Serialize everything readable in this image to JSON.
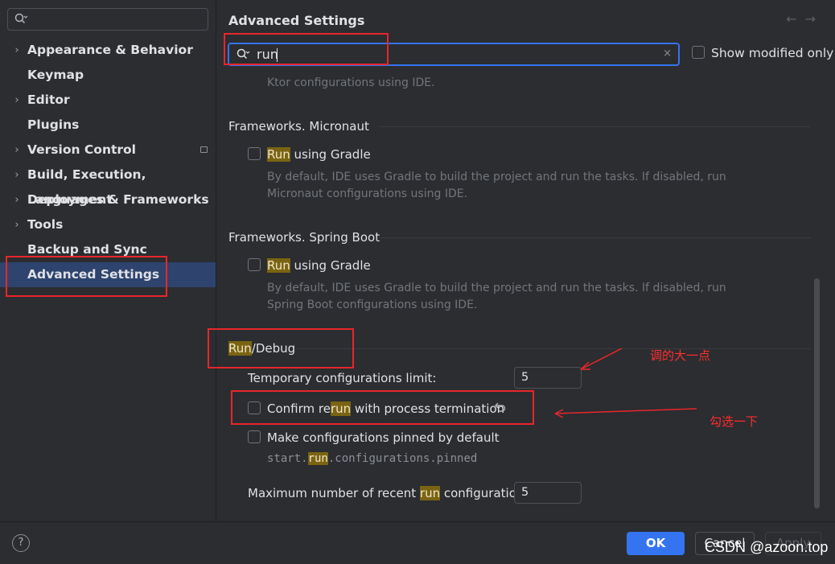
{
  "sidebar": {
    "search": {
      "value": ""
    },
    "items": [
      {
        "label": "Appearance & Behavior",
        "expandable": true
      },
      {
        "label": "Keymap",
        "expandable": false
      },
      {
        "label": "Editor",
        "expandable": true
      },
      {
        "label": "Plugins",
        "expandable": false
      },
      {
        "label": "Version Control",
        "expandable": true
      },
      {
        "label": "Build, Execution, Deployment",
        "expandable": true
      },
      {
        "label": "Languages & Frameworks",
        "expandable": true
      },
      {
        "label": "Tools",
        "expandable": true
      },
      {
        "label": "Backup and Sync",
        "expandable": false
      },
      {
        "label": "Advanced Settings",
        "expandable": false,
        "selected": true
      }
    ]
  },
  "header": {
    "title": "Advanced Settings",
    "back_arrow": "←",
    "forward_arrow": "→"
  },
  "search": {
    "value": "run",
    "clear_glyph": "×",
    "show_modified_label": "Show modified only"
  },
  "sections": {
    "ktor_tail": "Ktor configurations using IDE.",
    "micronaut": {
      "title": "Frameworks. Micronaut",
      "option_hl": "Run",
      "option_rest": " using Gradle",
      "desc_line1": "By default, IDE uses Gradle to build the project and run the tasks. If disabled, run",
      "desc_line2": "Micronaut configurations using IDE."
    },
    "spring": {
      "title": "Frameworks. Spring Boot",
      "option_hl": "Run",
      "option_rest": " using Gradle",
      "desc_line1": "By default, IDE uses Gradle to build the project and run the tasks. If disabled, run",
      "desc_line2": "Spring Boot configurations using IDE."
    },
    "rundebug": {
      "title_hl": "Run",
      "title_rest": "/Debug",
      "temp_limit_label": "Temporary configurations limit:",
      "temp_limit_value": "5",
      "confirm_pre": "Confirm re",
      "confirm_hl": "run",
      "confirm_post": " with process termination",
      "pinned_label": "Make configurations pinned by default",
      "pinned_key_pre": "start.",
      "pinned_key_hl": "run",
      "pinned_key_post": ".configurations.pinned",
      "max_recent_pre": "Maximum number of recent ",
      "max_recent_hl": "run",
      "max_recent_post": " configurations:",
      "max_recent_value": "5"
    }
  },
  "footer": {
    "help": "?",
    "ok": "OK",
    "cancel": "Cancel",
    "apply": "Apply"
  },
  "annotations": {
    "note1": "调的大一点",
    "note2": "勾选一下",
    "watermark": "CSDN @azoon.top",
    "color": "#e8262c"
  },
  "colors": {
    "accent": "#3574f0",
    "selection": "#2e436e",
    "highlight": "#7a6413"
  }
}
